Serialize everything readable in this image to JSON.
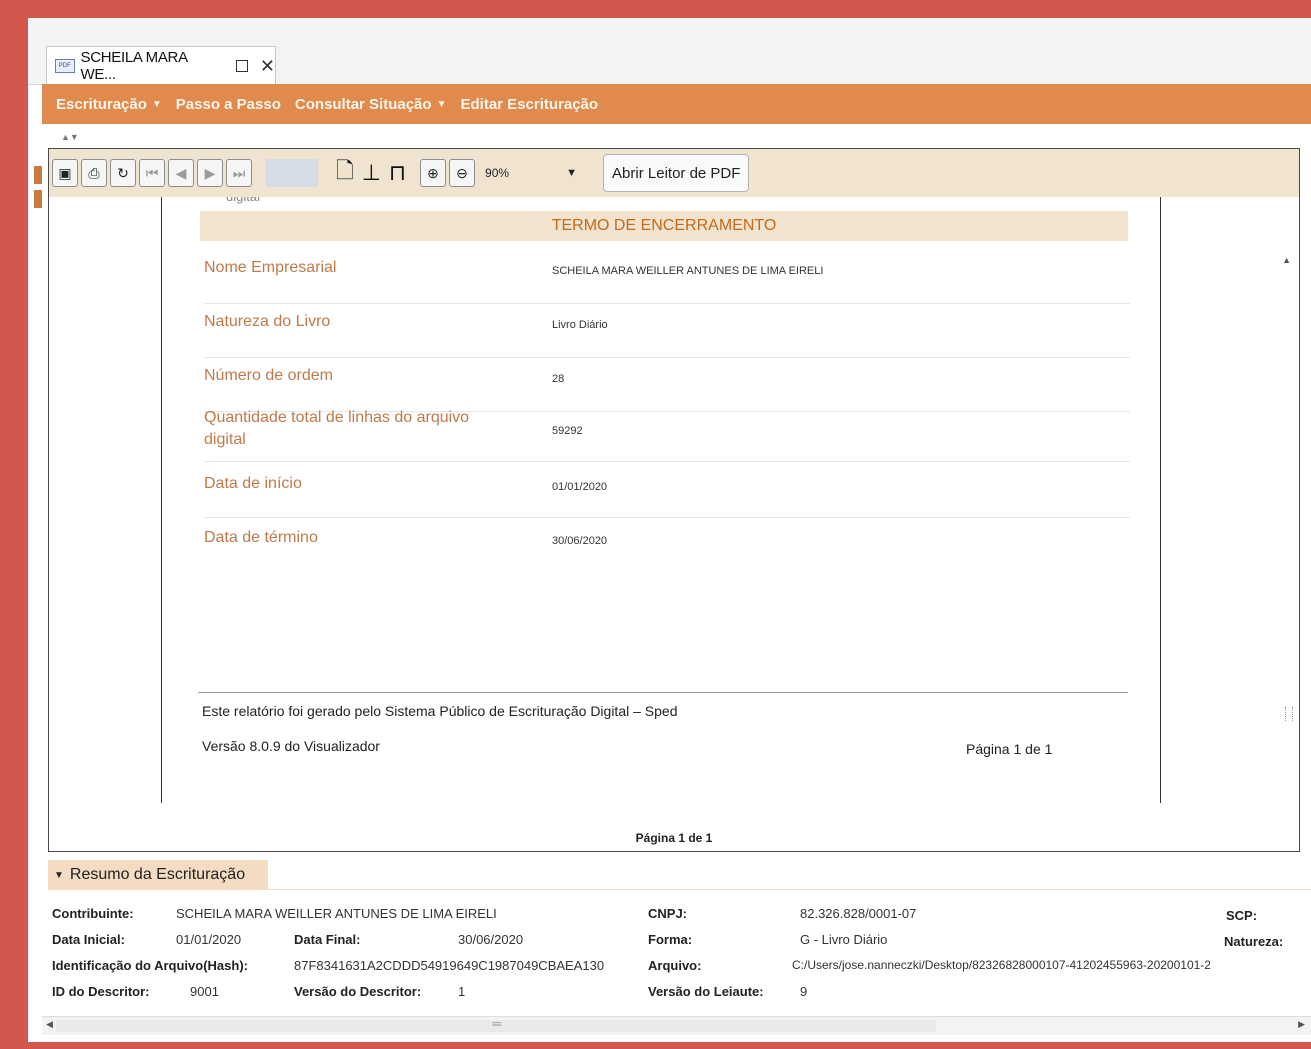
{
  "tab": {
    "title": "SCHEILA MARA WE...",
    "file_icon": "document-icon"
  },
  "menu": [
    {
      "label": "Escrituração",
      "has_caret": true
    },
    {
      "label": "Passo a Passo",
      "has_caret": false
    },
    {
      "label": "Consultar Situação",
      "has_caret": true
    },
    {
      "label": "Editar Escrituração",
      "has_caret": false
    }
  ],
  "toolbar": {
    "zoom_value": "90%",
    "pdf_button": "Abrir Leitor de PDF"
  },
  "report": {
    "partial_top_label": "digital",
    "section_title": "TERMO DE ENCERRAMENTO",
    "rows": [
      {
        "label": "Nome Empresarial",
        "value": "SCHEILA MARA WEILLER ANTUNES DE LIMA EIRELI"
      },
      {
        "label": "Natureza do Livro",
        "value": "Livro Diário"
      },
      {
        "label": "Número de ordem",
        "value": "28"
      },
      {
        "label": "Quantidade total de linhas do arquivo digital",
        "value": "59292"
      },
      {
        "label": "Data de início",
        "value": "01/01/2020"
      },
      {
        "label": "Data de término",
        "value": "30/06/2020"
      }
    ],
    "footer_generated": "Este relatório foi gerado pelo Sistema Público de Escrituração Digital – Sped",
    "footer_version": "Versão 8.0.9 do Visualizador",
    "footer_page": "Página 1 de 1"
  },
  "status_page": "Página 1 de 1",
  "summary": {
    "header": "Resumo da Escrituração",
    "contribuinte_label": "Contribuinte:",
    "contribuinte": "SCHEILA MARA WEILLER ANTUNES DE LIMA EIRELI",
    "cnpj_label": "CNPJ:",
    "cnpj": "82.326.828/0001-07",
    "scp_label": "SCP:",
    "data_inicial_label": "Data Inicial:",
    "data_inicial": "01/01/2020",
    "data_final_label": "Data Final:",
    "data_final": "30/06/2020",
    "forma_label": "Forma:",
    "forma": "G - Livro Diário",
    "natureza_label": "Natureza:",
    "hash_label": "Identificação do Arquivo(Hash):",
    "hash": "87F8341631A2CDDD54919649C1987049CBAEA130",
    "arquivo_label": "Arquivo:",
    "arquivo": "C:/Users/jose.nanneczki/Desktop/82326828000107-41202455963-20200101-2",
    "id_descritor_label": "ID do Descritor:",
    "id_descritor": "9001",
    "versao_descritor_label": "Versão do Descritor:",
    "versao_descritor": "1",
    "versao_leiaute_label": "Versão do Leiaute:",
    "versao_leiaute": "9"
  },
  "colors": {
    "accent": "#e08a4e",
    "frame": "#d2574d",
    "label": "#c07a4a",
    "title": "#c36b1a"
  }
}
